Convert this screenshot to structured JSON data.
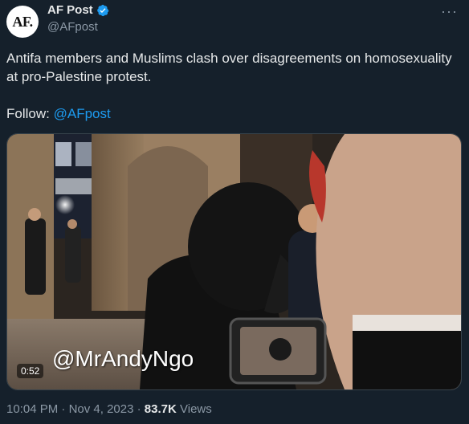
{
  "author": {
    "avatar_text": "AF.",
    "display_name": "AF Post",
    "handle": "@AFpost",
    "verified": true
  },
  "tweet": {
    "text": "Antifa members and Muslims clash over disagreements on homosexuality at pro-Palestine protest.",
    "follow_label": "Follow:",
    "follow_mention": "@AFpost"
  },
  "media": {
    "duration": "0:52",
    "watermark": "@MrAndyNgo"
  },
  "meta": {
    "time": "10:04 PM",
    "separator": "·",
    "date": "Nov 4, 2023",
    "views_count": "83.7K",
    "views_label": "Views"
  },
  "icons": {
    "more": "more-options-icon",
    "verified": "verified-badge-icon"
  },
  "colors": {
    "background": "#15202b",
    "accent": "#1d9bf0",
    "muted": "#8b98a5",
    "text": "#e7e9ea"
  }
}
